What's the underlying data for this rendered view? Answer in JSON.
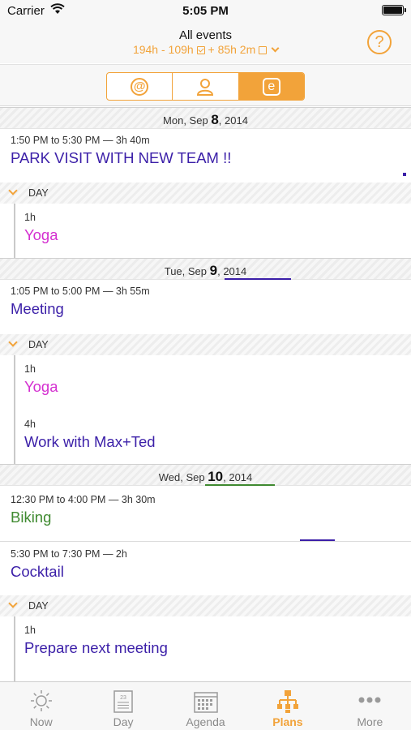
{
  "status_bar": {
    "carrier": "Carrier",
    "time": "5:05 PM"
  },
  "header": {
    "title": "All events",
    "stat_total": "194h",
    "stat_done": "109h",
    "stat_left": "85h 2m",
    "help_glyph": "?"
  },
  "segments": [
    {
      "name": "at-sign-icon",
      "glyph": "@",
      "active": false
    },
    {
      "name": "person-icon",
      "glyph": "",
      "active": false
    },
    {
      "name": "event-e-icon",
      "glyph": "e",
      "active": true
    }
  ],
  "accent_color": "#f2a33a",
  "days": [
    {
      "date_prefix": "Mon, Sep ",
      "date_day": "8",
      "date_suffix": ", 2014",
      "events": [
        {
          "time": "1:50 PM to 5:30 PM — 3h 40m",
          "title": "PARK VISIT WITH NEW TEAM !!",
          "color": "#3b1fa8"
        }
      ],
      "day_label": "DAY",
      "day_items": [
        {
          "duration": "1h",
          "title": "Yoga",
          "color": "#d42fd0"
        }
      ]
    },
    {
      "date_prefix": "Tue, Sep ",
      "date_day": "9",
      "date_suffix": ", 2014",
      "events": [
        {
          "time": "1:05 PM to 5:00 PM — 3h 55m",
          "title": "Meeting",
          "color": "#3b1fa8"
        }
      ],
      "day_label": "DAY",
      "day_items": [
        {
          "duration": "1h",
          "title": "Yoga",
          "color": "#d42fd0"
        },
        {
          "duration": "4h",
          "title": "Work with Max+Ted",
          "color": "#3b1fa8"
        }
      ]
    },
    {
      "date_prefix": "Wed, Sep ",
      "date_day": "10",
      "date_suffix": ", 2014",
      "events": [
        {
          "time": "12:30 PM to 4:00 PM — 3h 30m",
          "title": "Biking",
          "color": "#3f8a30"
        },
        {
          "time": "5:30 PM to 7:30 PM — 2h",
          "title": "Cocktail",
          "color": "#3b1fa8"
        }
      ],
      "day_label": "DAY",
      "day_items": [
        {
          "duration": "1h",
          "title": "Prepare next meeting",
          "color": "#3b1fa8"
        }
      ]
    }
  ],
  "tabs": [
    {
      "label": "Now",
      "icon": "sun-icon",
      "active": false
    },
    {
      "label": "Day",
      "icon": "calendar-day-icon",
      "active": false
    },
    {
      "label": "Agenda",
      "icon": "calendar-grid-icon",
      "active": false
    },
    {
      "label": "Plans",
      "icon": "org-chart-icon",
      "active": true
    },
    {
      "label": "More",
      "icon": "ellipsis-icon",
      "active": false
    }
  ]
}
